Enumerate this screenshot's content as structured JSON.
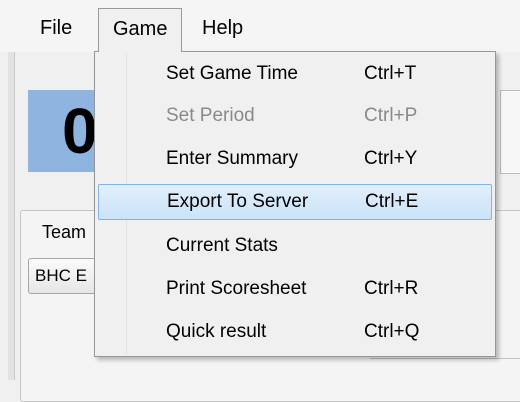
{
  "menubar": {
    "file": "File",
    "game": "Game",
    "help": "Help"
  },
  "background": {
    "score_digit": "0",
    "team_label": "Team",
    "team_value": "BHC E"
  },
  "game_menu": {
    "items": [
      {
        "label": "Set Game Time",
        "shortcut": "Ctrl+T",
        "enabled": true,
        "highlighted": false
      },
      {
        "label": "Set Period",
        "shortcut": "Ctrl+P",
        "enabled": false,
        "highlighted": false
      },
      {
        "label": "Enter Summary",
        "shortcut": "Ctrl+Y",
        "enabled": true,
        "highlighted": false
      },
      {
        "label": "Export To Server",
        "shortcut": "Ctrl+E",
        "enabled": true,
        "highlighted": true
      },
      {
        "label": "Current Stats",
        "shortcut": "",
        "enabled": true,
        "highlighted": false
      },
      {
        "label": "Print Scoresheet",
        "shortcut": "Ctrl+R",
        "enabled": true,
        "highlighted": false
      },
      {
        "label": "Quick result",
        "shortcut": "Ctrl+Q",
        "enabled": true,
        "highlighted": false
      }
    ]
  }
}
